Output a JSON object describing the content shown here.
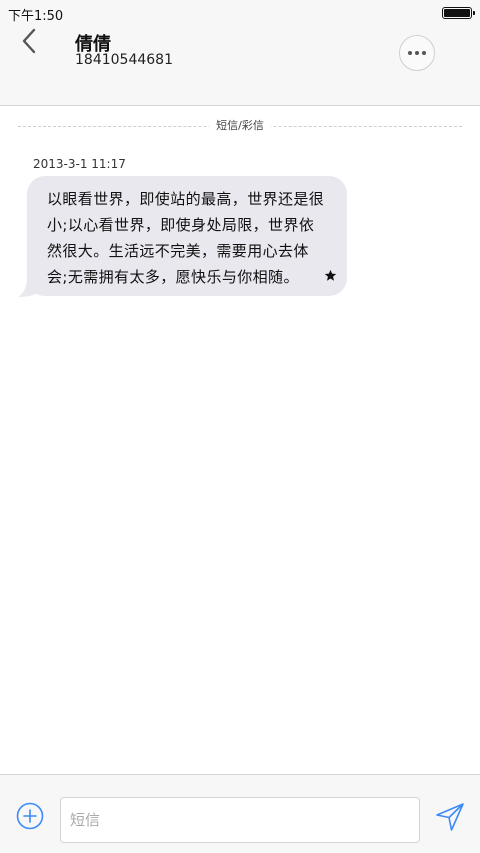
{
  "status_bar": {
    "time": "下午1:50",
    "battery_level": 1.0
  },
  "header": {
    "contact_name": "倩倩",
    "contact_number": "18410544681",
    "back_icon": "chevron-left-icon",
    "more_icon": "more-horizontal-icon"
  },
  "conversation": {
    "type_label": "短信/彩信",
    "messages": [
      {
        "timestamp": "2013-3-1 11:17",
        "text": "以眼看世界，即使站的最高，世界还是很小;以心看世界，即使身处局限，世界依然很大。生活远不完美，需要用心去体会;无需拥有太多，愿快乐与你相随。",
        "starred": true
      }
    ]
  },
  "composer": {
    "placeholder": "短信",
    "value": "",
    "add_icon": "add-circle-icon",
    "send_icon": "send-icon"
  },
  "colors": {
    "accent": "#3d8af7",
    "bubble": "#e8e8ee",
    "bar_background": "#f7f7f7"
  }
}
